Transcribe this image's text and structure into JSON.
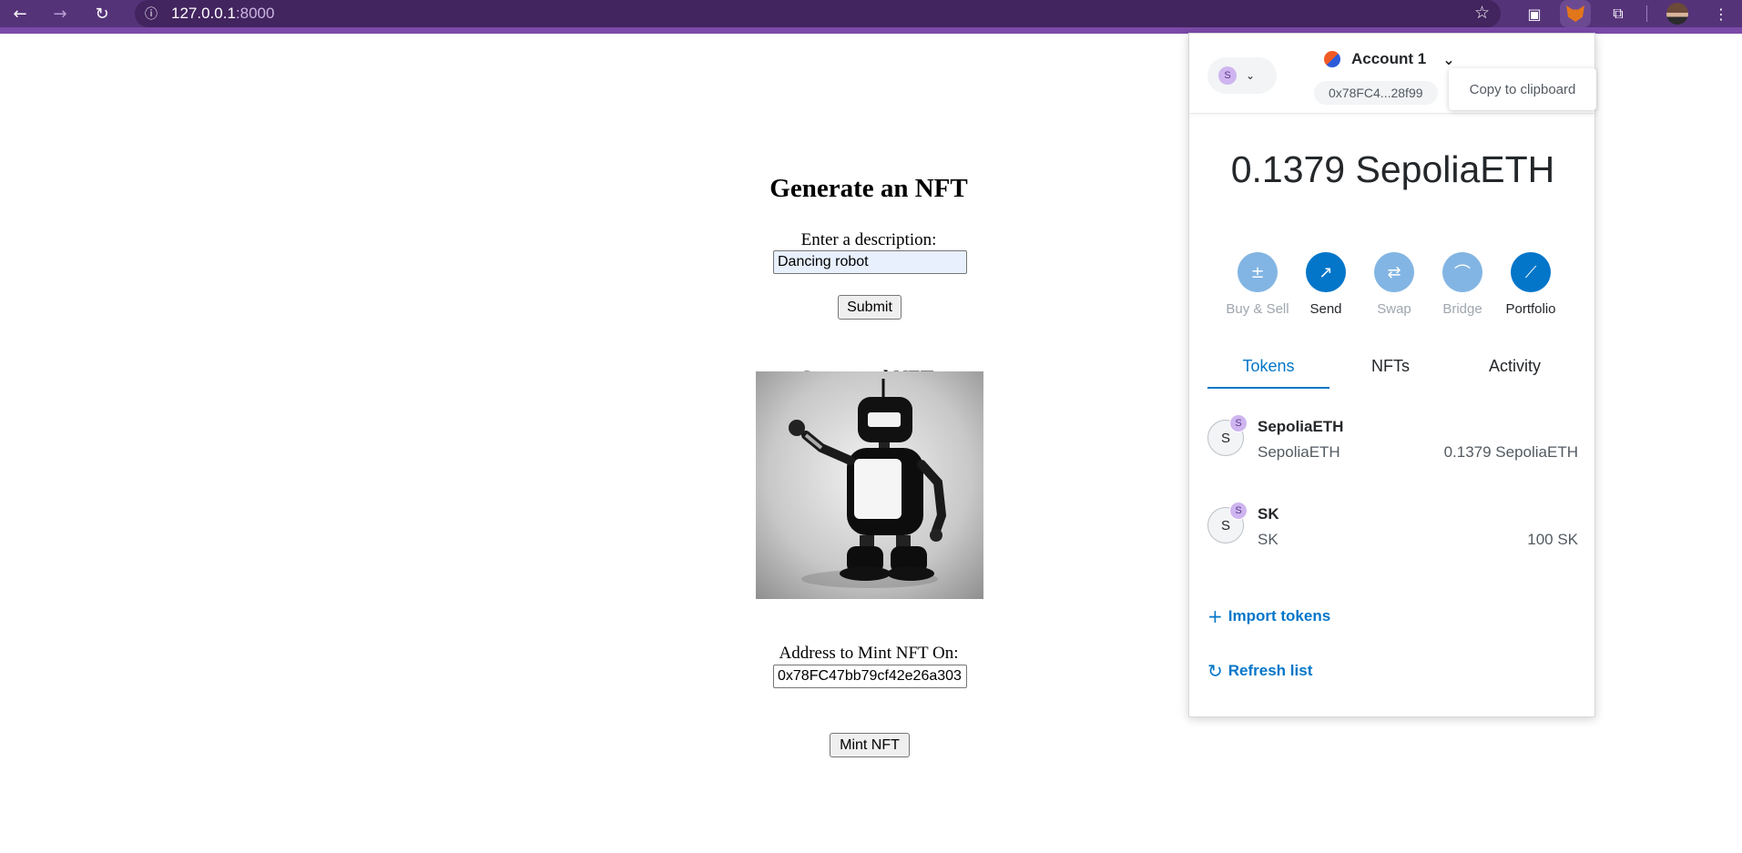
{
  "browser": {
    "url_host": "127.0.0.1",
    "url_port": ":8000"
  },
  "page": {
    "title": "Generate an NFT",
    "description_label": "Enter a description:",
    "description_value": "Dancing robot",
    "submit_label": "Submit",
    "generated_heading": "Generated NFT:",
    "address_label": "Address to Mint NFT On:",
    "address_value": "0x78FC47bb79cf42e26a303",
    "mint_label": "Mint NFT"
  },
  "metamask": {
    "network_initial": "S",
    "account_name": "Account 1",
    "address_short": "0x78FC4...28f99",
    "tooltip": "Copy to clipboard",
    "balance": "0.1379 SepoliaETH",
    "actions": [
      {
        "label": "Buy & Sell",
        "icon": "buy-sell-icon",
        "enabled": false
      },
      {
        "label": "Send",
        "icon": "send-arrow-icon",
        "enabled": true
      },
      {
        "label": "Swap",
        "icon": "swap-icon",
        "enabled": false
      },
      {
        "label": "Bridge",
        "icon": "bridge-icon",
        "enabled": false
      },
      {
        "label": "Portfolio",
        "icon": "portfolio-chart-icon",
        "enabled": true
      }
    ],
    "tabs": [
      "Tokens",
      "NFTs",
      "Activity"
    ],
    "active_tab": "Tokens",
    "tokens": [
      {
        "icon_letter": "S",
        "badge": "S",
        "name": "SepoliaETH",
        "symbol": "SepoliaETH",
        "balance": "0.1379 SepoliaETH"
      },
      {
        "icon_letter": "S",
        "badge": "S",
        "name": "SK",
        "symbol": "SK",
        "balance": "100 SK"
      }
    ],
    "import_label": "Import tokens",
    "refresh_label": "Refresh list"
  },
  "colors": {
    "browser_bar": "#553379",
    "metamask_accent": "#0376c9",
    "action_disabled": "#82b5e3"
  }
}
